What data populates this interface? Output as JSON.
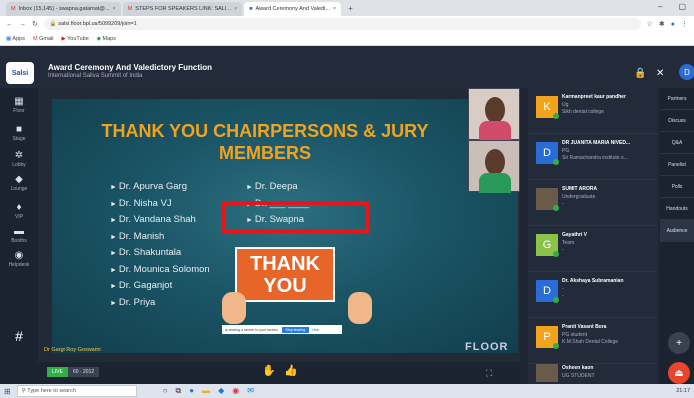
{
  "browser": {
    "tabs": [
      {
        "label": "Inbox (15,145) - swapna.gatamat@...",
        "active": false
      },
      {
        "label": "STEPS FOR SPEAKERS LINK: SALI...",
        "active": false
      },
      {
        "label": "Award Ceremony And Valedi...",
        "active": true
      }
    ],
    "new_tab": "+",
    "url": "salsi.floor.bpl.us/5099209/join=1",
    "bookmarks": [
      "Apps",
      "Gmail",
      "YouTube",
      "Maps"
    ]
  },
  "event": {
    "logo": "Salsi",
    "title": "Award Ceremony And Valedictory Function",
    "subtitle": "International Saliva Summit of India",
    "user_initial": "D"
  },
  "sidebar": [
    {
      "icon": "floor-icon",
      "glyph": "▦",
      "label": "Floor"
    },
    {
      "icon": "stage-icon",
      "glyph": "■",
      "label": "Stage"
    },
    {
      "icon": "lobby-icon",
      "glyph": "✲",
      "label": "Lobby"
    },
    {
      "icon": "lounge-icon",
      "glyph": "◆",
      "label": "Lounge"
    },
    {
      "icon": "vip-icon",
      "glyph": "♦",
      "label": "VIP"
    },
    {
      "icon": "booths-icon",
      "glyph": "▬",
      "label": "Booths"
    },
    {
      "icon": "helpdesk-icon",
      "glyph": "◉",
      "label": "Helpdesk"
    }
  ],
  "slide": {
    "title": "THANK YOU CHAIRPERSONS & JURY MEMBERS",
    "col1": [
      "Dr. Apurva Garg",
      "Dr. Nisha VJ",
      "Dr. Vandana Shah",
      "Dr. Manish",
      "Dr. Shakuntala",
      "Dr. Mounica Solomon",
      "Dr. Gaganjot",
      "Dr. Priya"
    ],
    "col2": [
      "Dr. Deepa",
      "Dr. ___ ____",
      "Dr. Swapna"
    ],
    "thank": "THANK",
    "you": "YOU",
    "share_text": "is sharing a screen to your screen.",
    "share_stop": "Stop sharing",
    "share_hide": "Hide"
  },
  "stage": {
    "speaker": "Dr Gargi Roy Goswami",
    "watermark": "FLOOR",
    "live": "LIVE",
    "views": "60 · 2012"
  },
  "participants": [
    {
      "initial": "K",
      "color": "#f2a31d",
      "name": "Karmanpreet kaur pandher",
      "l1": "Ug",
      "l2": "Sikh dental college"
    },
    {
      "initial": "D",
      "color": "#2a6cd6",
      "name": "DR JUANITA MARIA NIVED...",
      "l1": "PG",
      "l2": "Sri Ramachandra institute o..."
    },
    {
      "initial": "",
      "color": "#6a5a4a",
      "name": "SUMIT ARORA",
      "l1": "Undergraduate",
      "l2": "-"
    },
    {
      "initial": "G",
      "color": "#8bc34a",
      "name": "Gayathri V",
      "l1": "Team",
      "l2": "-"
    },
    {
      "initial": "D",
      "color": "#2a6cd6",
      "name": "Dr. Akshaya Subramanian",
      "l1": "-",
      "l2": "-"
    },
    {
      "initial": "P",
      "color": "#f2a31d",
      "name": "Pranit Vasant Bora",
      "l1": "PG student",
      "l2": "K.M.Shah Dental College"
    },
    {
      "initial": "",
      "color": "#6a5a4a",
      "name": "Osheen kaon",
      "l1": "UG STUDENT",
      "l2": ""
    }
  ],
  "right_tabs": [
    "Partners",
    "Discuss",
    "Q&A",
    "Panelist",
    "Polls",
    "Handouts",
    "Audience"
  ],
  "taskbar": {
    "search": "Type here to search",
    "time": "21:17"
  },
  "colors": {
    "accent": "#f2a31d",
    "highlight": "#e8141a",
    "live": "#2fae4a"
  }
}
